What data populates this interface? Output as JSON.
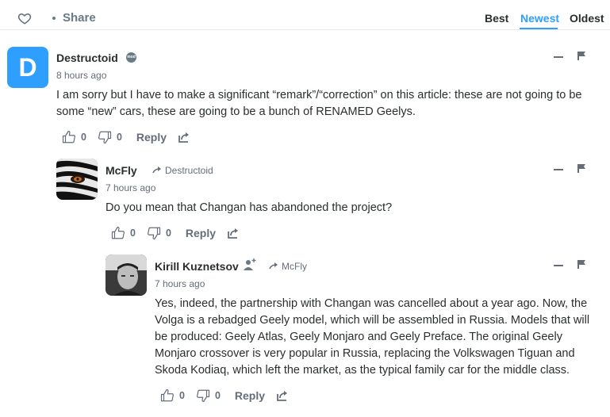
{
  "header": {
    "share_label": "Share",
    "sort_tabs": [
      "Best",
      "Newest",
      "Oldest"
    ],
    "active_sort": "Newest",
    "accent_color": "#2e9fff"
  },
  "comments": [
    {
      "author": "Destructoid",
      "avatar_letter": "D",
      "avatar_color": "#2e9fff",
      "badge": "mod",
      "time": "8 hours ago",
      "body": "I am sorry but I have to make a significant “remark”/“correction” on this article: these are not going to be some “new” cars, these are going to be a bunch of RENAMED Geelys.",
      "upvotes": "0",
      "downvotes": "0",
      "reply_label": "Reply"
    },
    {
      "author": "McFly",
      "in_reply_to": "Destructoid",
      "time": "7 hours ago",
      "body": "Do you mean that Changan has abandoned the project?",
      "upvotes": "0",
      "downvotes": "0",
      "reply_label": "Reply"
    },
    {
      "author": "Kirill Kuznetsov",
      "in_reply_to": "McFly",
      "time": "7 hours ago",
      "body": "Yes, indeed, the partnership with Changan was cancelled about a year ago. Now, the Volga is a rebadged Geely model, which will be assembled in Russia. Models that will be produced: Geely Atlas, Geely Monjaro and Geely Preface. The original Geely Monjaro crossover is very popular in Russia, replacing the Volkswagen Tiguan and Skoda Kodiaq, which left the market, as the typical family car for the middle class.",
      "upvotes": "0",
      "downvotes": "0",
      "reply_label": "Reply"
    }
  ]
}
